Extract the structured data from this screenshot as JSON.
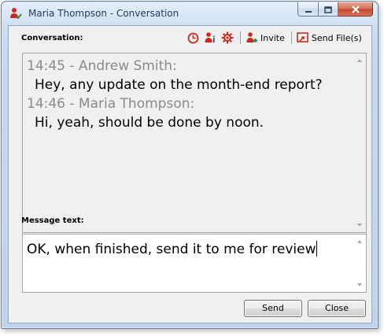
{
  "window": {
    "title": "Maria Thompson - Conversation",
    "icon": "user-icon"
  },
  "caption_buttons": {
    "minimize": "minimize-icon",
    "maximize": "maximize-icon",
    "close": "close-icon"
  },
  "conversation": {
    "label": "Conversation:",
    "toolbar": {
      "history_icon": "clock-icon",
      "info_icon": "user-info-icon",
      "settings_icon": "gear-icon",
      "invite_label": "Invite",
      "send_files_label": "Send File(s)"
    },
    "messages": [
      {
        "header": "14:45 - Andrew Smith:",
        "text": "Hey, any update on the month-end report?"
      },
      {
        "header": "14:46 - Maria Thompson:",
        "text": "Hi, yeah, should be done by noon."
      }
    ]
  },
  "message": {
    "label": "Message text:",
    "value": "OK, when finished, send it to me for review"
  },
  "buttons": {
    "send": "Send",
    "close": "Close"
  },
  "colors": {
    "accent_red": "#d0281c",
    "header_gray": "#8a8a8a",
    "title_text": "#1e395b"
  }
}
